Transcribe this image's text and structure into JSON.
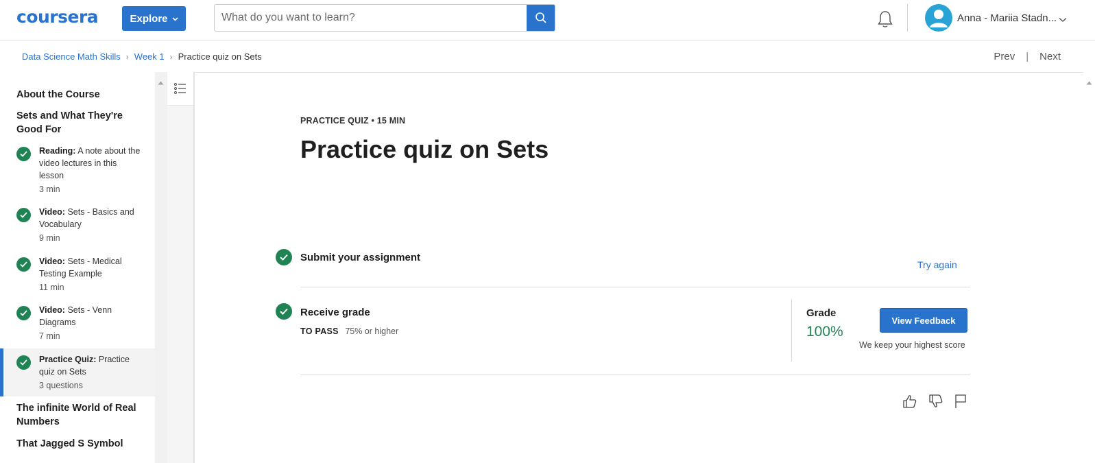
{
  "header": {
    "logo": "coursera",
    "explore_label": "Explore",
    "search_placeholder": "What do you want to learn?",
    "user_name": "Anna - Mariia Stadn..."
  },
  "breadcrumb": {
    "items": [
      "Data Science Math Skills",
      "Week 1"
    ],
    "current": "Practice quiz on Sets",
    "prev_label": "Prev",
    "next_label": "Next"
  },
  "sidebar": {
    "about": "About the Course",
    "section_title": "Sets and What They're Good For",
    "items": [
      {
        "type": "Reading:",
        "title": "A note about the video lectures in this lesson",
        "meta": "3 min"
      },
      {
        "type": "Video:",
        "title": "Sets - Basics and Vocabulary",
        "meta": "9 min"
      },
      {
        "type": "Video:",
        "title": "Sets - Medical Testing Example",
        "meta": "11 min"
      },
      {
        "type": "Video:",
        "title": "Sets - Venn Diagrams",
        "meta": "7 min"
      },
      {
        "type": "Practice Quiz:",
        "title": "Practice quiz on Sets",
        "meta": "3 questions"
      }
    ],
    "next_sections": [
      "The infinite World of Real Numbers",
      "That Jagged S Symbol"
    ]
  },
  "main": {
    "meta": "PRACTICE QUIZ • 15 MIN",
    "title": "Practice quiz on Sets",
    "submit_title": "Submit your assignment",
    "try_again": "Try again",
    "receive_title": "Receive grade",
    "to_pass_label": "TO PASS",
    "to_pass_value": "75% or higher",
    "grade_label": "Grade",
    "grade_value": "100%",
    "feedback_button": "View Feedback",
    "highest_note": "We keep your highest score"
  },
  "colors": {
    "accent": "#2a73cc",
    "success": "#1f8354"
  }
}
